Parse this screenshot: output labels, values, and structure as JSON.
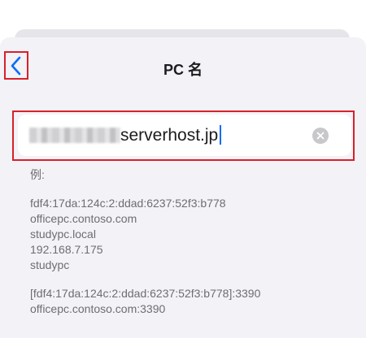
{
  "nav": {
    "title": "PC 名",
    "back_icon": "chevron-left-icon"
  },
  "field": {
    "value": "serverhost.jp",
    "clear_icon": "clear-circle-icon"
  },
  "hints": {
    "heading": "例:",
    "group1": [
      "fdf4:17da:124c:2:ddad:6237:52f3:b778",
      "officepc.contoso.com",
      "studypc.local",
      "192.168.7.175",
      "studypc"
    ],
    "group2": [
      "[fdf4:17da:124c:2:ddad:6237:52f3:b778]:3390",
      "officepc.contoso.com:3390"
    ]
  },
  "colors": {
    "accent": "#0a6cf5",
    "highlight": "#d9202a",
    "sheet_bg": "#f2f2f7"
  }
}
